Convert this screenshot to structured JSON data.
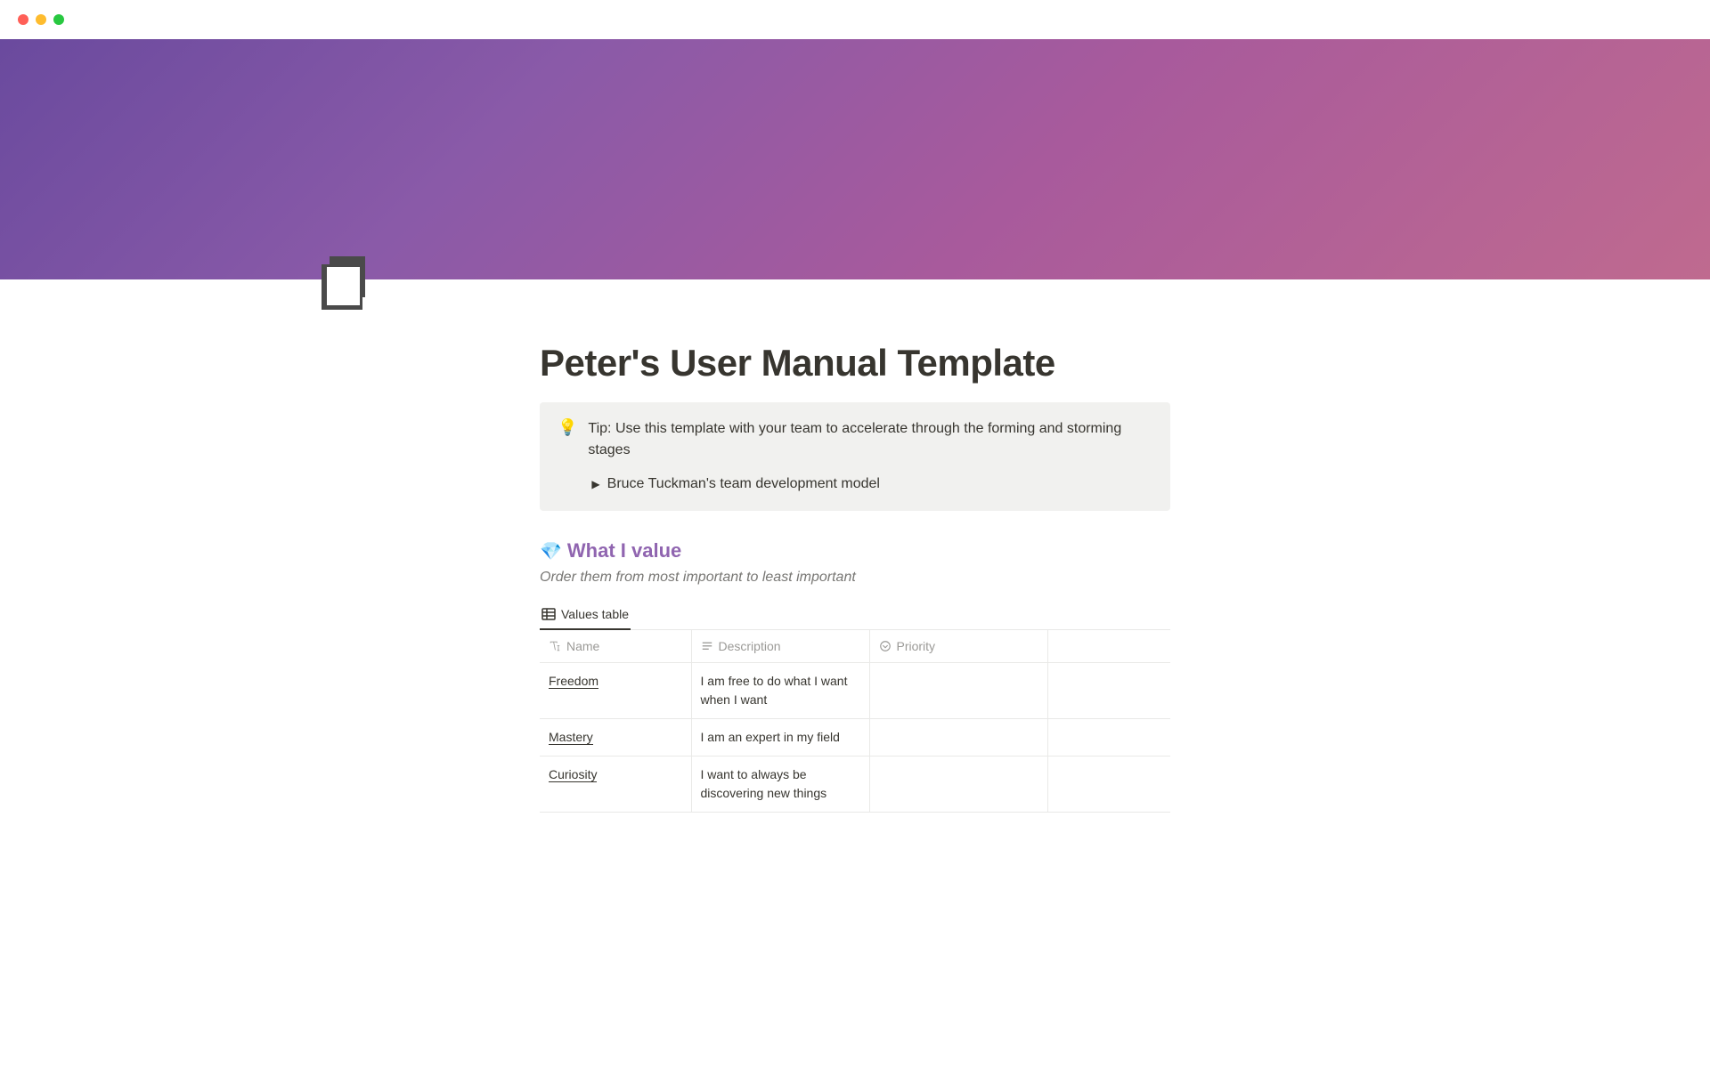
{
  "page": {
    "title": "Peter's User Manual Template",
    "icon": "notebook"
  },
  "callout": {
    "icon": "💡",
    "text": "Tip: Use this template with your team to accelerate through the forming and storming stages",
    "toggle_label": "Bruce Tuckman's team development model"
  },
  "section": {
    "emoji": "💎",
    "heading": "What I value",
    "subtitle": "Order them from most important to least important"
  },
  "view": {
    "tab_label": "Values table"
  },
  "table": {
    "columns": {
      "name": "Name",
      "description": "Description",
      "priority": "Priority"
    },
    "rows": [
      {
        "name": "Freedom",
        "description": "I am free to do what I want when I want",
        "priority": ""
      },
      {
        "name": "Mastery",
        "description": "I am an expert in my field",
        "priority": ""
      },
      {
        "name": "Curiosity",
        "description": "I want to always be discovering new things",
        "priority": ""
      }
    ]
  }
}
